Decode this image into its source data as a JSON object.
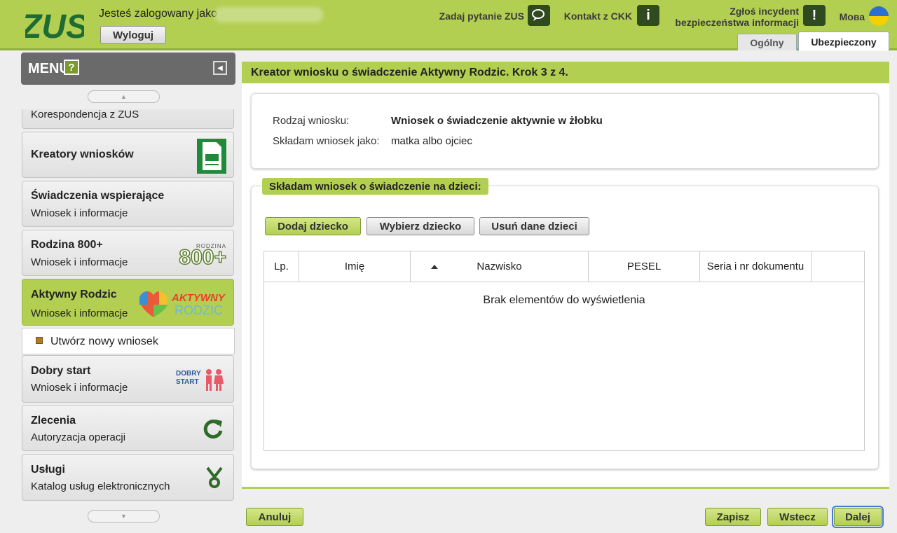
{
  "header": {
    "logged_in_text": "Jesteś zalogowany jako",
    "logout_label": "Wyloguj",
    "ask_question": "Zadaj pytanie ZUS",
    "contact_ckk": "Kontakt z CKK",
    "report_line1": "Zgłoś incydent",
    "report_line2": "bezpieczeństwa informacji",
    "language": "Мова",
    "tab_general": "Ogólny",
    "tab_insured": "Ubezpieczony"
  },
  "sidebar": {
    "menu_title": "MENU",
    "help": "?",
    "partial_item": "Korespondencja z ZUS",
    "items": [
      {
        "title": "Kreatory wniosków",
        "subtitle": "",
        "icon": "document-form-icon"
      },
      {
        "title": "Świadczenia wspierające",
        "subtitle": "Wniosek i informacje",
        "icon": ""
      },
      {
        "title": "Rodzina 800+",
        "subtitle": "Wniosek i informacje",
        "icon": "rodzina-800-logo"
      },
      {
        "title": "Aktywny Rodzic",
        "subtitle": "Wniosek i informacje",
        "icon": "aktywny-rodzic-logo"
      },
      {
        "title": "Dobry start",
        "subtitle": "Wniosek i informacje",
        "icon": "dobry-start-logo"
      },
      {
        "title": "Zlecenia",
        "subtitle": "Autoryzacja operacji",
        "icon": "refresh-icon"
      },
      {
        "title": "Usługi",
        "subtitle": "Katalog usług elektronicznych",
        "icon": "services-icon"
      }
    ],
    "submenu_new_application": "Utwórz nowy wniosek",
    "logos": {
      "rodzina_small": "RODZINA",
      "rodzina_big": "800+",
      "aktywny_top": "AKTYWNY",
      "aktywny_bottom": "RODZIC",
      "dobry_top": "DOBRY",
      "dobry_bottom": "START"
    }
  },
  "main": {
    "title": "Kreator wniosku o świadczenie Aktywny Rodzic. Krok 3 z 4.",
    "summary": {
      "type_label": "Rodzaj wniosku:",
      "type_value": "Wniosek o świadczenie aktywnie w żłobku",
      "as_label": "Składam wniosek jako:",
      "as_value": "matka albo ojciec"
    },
    "children_section_title": "Składam wniosek o świadczenie na dzieci:",
    "buttons": {
      "add_child": "Dodaj dziecko",
      "choose_child": "Wybierz dziecko",
      "remove_children": "Usuń dane dzieci"
    },
    "table": {
      "columns": [
        "Lp.",
        "Imię",
        "Nazwisko",
        "PESEL",
        "Seria i nr dokumentu",
        ""
      ],
      "sorted_column": "Imię",
      "empty_message": "Brak elementów do wyświetlenia"
    }
  },
  "footer": {
    "cancel": "Anuluj",
    "save": "Zapisz",
    "back": "Wstecz",
    "next": "Dalej"
  },
  "colors": {
    "brand_green": "#b3cf51",
    "logo_green": "#1f6b34",
    "menu_gray": "#6a6a6a"
  }
}
